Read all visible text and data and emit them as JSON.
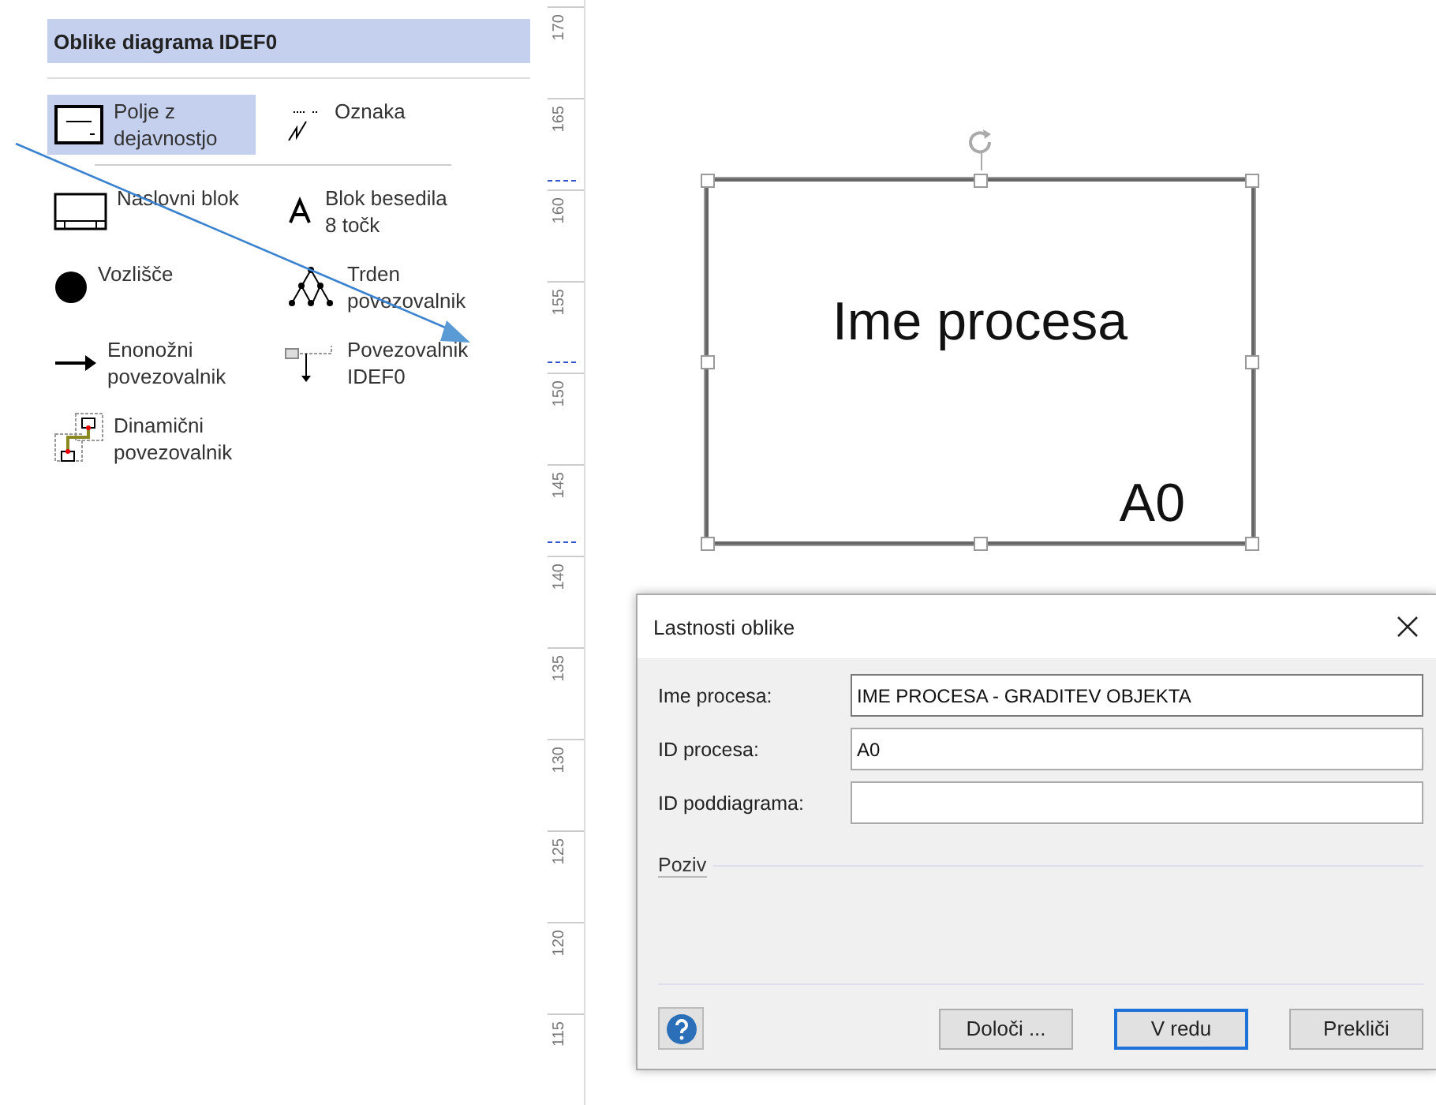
{
  "stencil": {
    "title": "Oblike diagrama IDEF0",
    "items": [
      {
        "label": "Polje z dejavnostjo",
        "kind": "activity",
        "selected": true
      },
      {
        "label": "Oznaka",
        "kind": "label",
        "selected": false
      },
      {
        "label": "Naslovni blok",
        "kind": "title",
        "selected": false
      },
      {
        "label": "Blok besedila 8 točk",
        "kind": "text",
        "selected": false
      },
      {
        "label": "Vozlišče",
        "kind": "node",
        "selected": false
      },
      {
        "label": "Trden povezovalnik",
        "kind": "tree",
        "selected": false
      },
      {
        "label": "Enonožni povezovalnik",
        "kind": "arrow",
        "selected": false
      },
      {
        "label": "Povezovalnik IDEF0",
        "kind": "idef",
        "selected": false
      },
      {
        "label": "Dinamični povezovalnik",
        "kind": "dynamic",
        "selected": false
      }
    ]
  },
  "ruler": {
    "ticks": [
      "170",
      "165",
      "160",
      "155",
      "150",
      "145",
      "140",
      "135",
      "130",
      "125",
      "120",
      "115"
    ]
  },
  "shape": {
    "title": "Ime procesa",
    "id": "A0"
  },
  "dialog": {
    "title": "Lastnosti oblike",
    "fields": [
      {
        "label": "Ime procesa:",
        "value": "IME PROCESA - GRADITEV OBJEKTA",
        "focused": true
      },
      {
        "label": "ID procesa:",
        "value": "A0",
        "focused": false
      },
      {
        "label": "ID poddiagrama:",
        "focused": false
      }
    ],
    "section": "Poziv",
    "buttons": [
      {
        "label": "Določi ...",
        "default": false
      },
      {
        "label": "V redu",
        "default": true
      },
      {
        "label": "Prekliči",
        "default": false
      }
    ]
  }
}
